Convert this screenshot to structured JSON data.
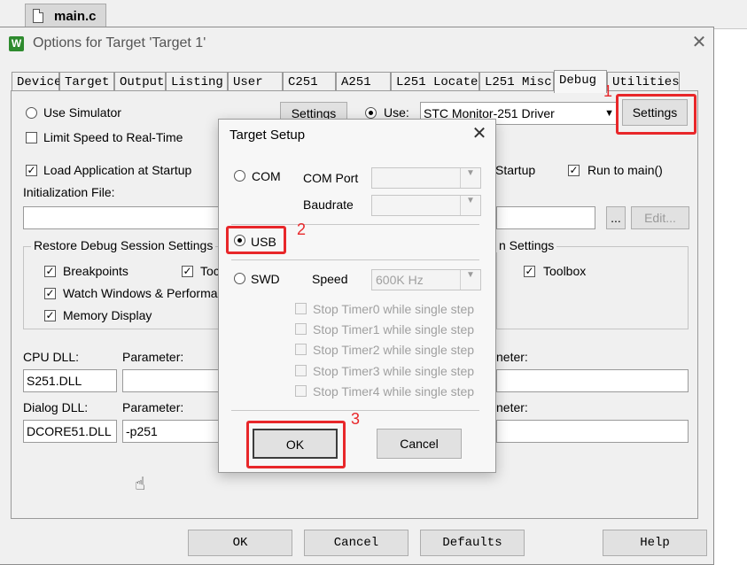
{
  "editor": {
    "file_tab": "main.c"
  },
  "dialog": {
    "title": "Options for Target 'Target 1'",
    "close": "✕",
    "tabs": [
      "Device",
      "Target",
      "Output",
      "Listing",
      "User",
      "C251",
      "A251",
      "L251 Locate",
      "L251 Misc",
      "Debug",
      "Utilities"
    ],
    "active_tab": "Debug",
    "left": {
      "use_simulator": "Use Simulator",
      "settings": "Settings",
      "limit_speed": "Limit Speed to Real-Time",
      "load_app": "Load Application at Startup",
      "init_file": "Initialization File:",
      "restore_group": "Restore Debug Session Settings",
      "breakpoints": "Breakpoints",
      "toolbox_partial": "Toc",
      "watch_windows": "Watch Windows & Performar",
      "memory_display": "Memory Display",
      "cpu_dll": "CPU DLL:",
      "cpu_param": "Parameter:",
      "cpu_dll_value": "S251.DLL",
      "dialog_dll": "Dialog DLL:",
      "dialog_param": "Parameter:",
      "dialog_dll_value": "DCORE51.DLL",
      "dialog_param_value": "-p251"
    },
    "right": {
      "use": "Use:",
      "driver": "STC Monitor-251 Driver",
      "settings": "Settings",
      "startup_partial": "Startup",
      "run_to_main": "Run to main()",
      "browse": "...",
      "edit": "Edit...",
      "group_partial": "n Settings",
      "toolbox": "Toolbox",
      "param_partial_1": "neter:",
      "param_partial_2": "neter:"
    },
    "buttons": {
      "ok": "OK",
      "cancel": "Cancel",
      "defaults": "Defaults",
      "help": "Help"
    }
  },
  "modal": {
    "title": "Target Setup",
    "close": "✕",
    "com": "COM",
    "com_port": "COM Port",
    "baudrate": "Baudrate",
    "usb": "USB",
    "swd": "SWD",
    "speed": "Speed",
    "speed_value": "600K Hz",
    "timers": [
      "Stop Timer0 while single step",
      "Stop Timer1 while single step",
      "Stop Timer2 while single step",
      "Stop Timer3 while single step",
      "Stop Timer4 while single step"
    ],
    "ok": "OK",
    "cancel": "Cancel"
  },
  "annotations": {
    "n1": "1",
    "n2": "2",
    "n3": "3"
  },
  "colors": {
    "highlight": "#e8272a"
  },
  "icons": {
    "file": "document-icon",
    "app": "keil-uvision-icon",
    "cursor": "hand-cursor-icon"
  }
}
